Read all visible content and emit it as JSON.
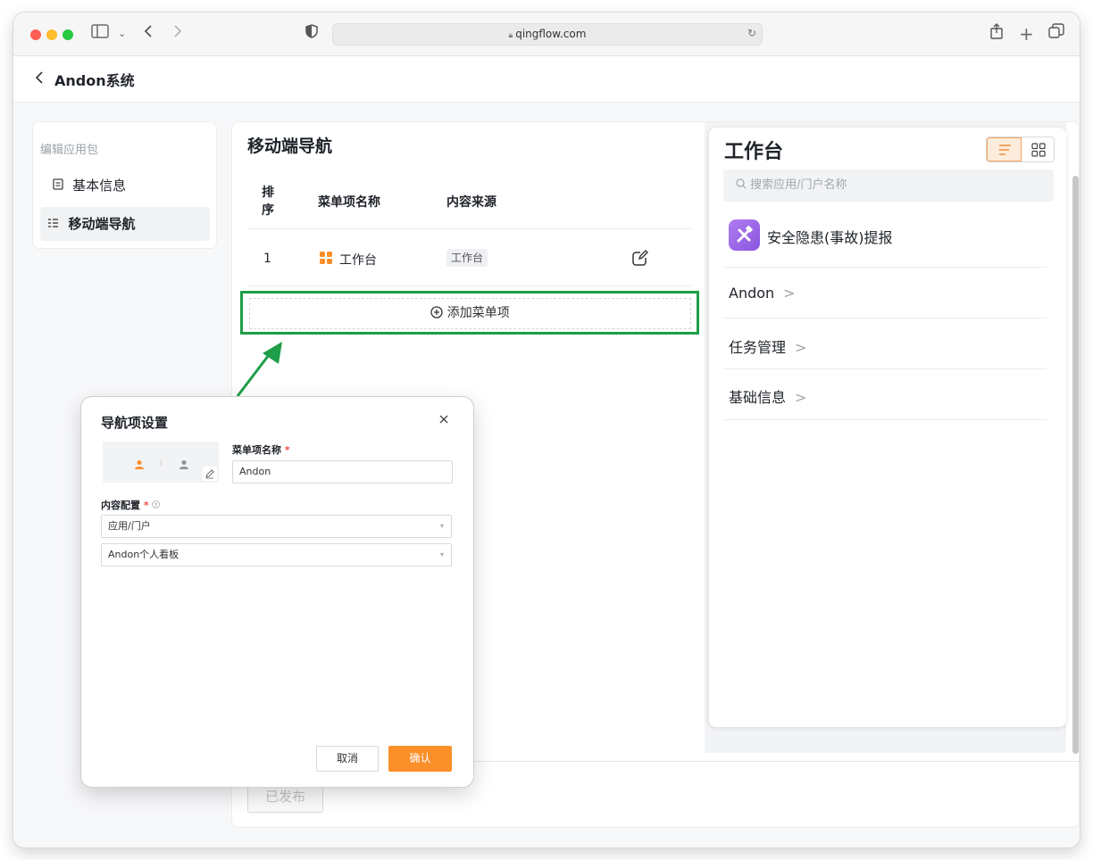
{
  "browser": {
    "url": "qingflow.com"
  },
  "header": {
    "back_icon": "chevron-left",
    "title": "Andon系统"
  },
  "sidebar": {
    "heading": "编辑应用包",
    "items": [
      {
        "label": "基本信息",
        "icon": "doc-icon",
        "active": false
      },
      {
        "label": "移动端导航",
        "icon": "list-icon",
        "active": true
      }
    ]
  },
  "main": {
    "title": "移动端导航",
    "columns": [
      "排序",
      "菜单项名称",
      "内容来源"
    ],
    "rows": [
      {
        "order": "1",
        "name": "工作台",
        "source": "工作台"
      }
    ],
    "add_label": "添加菜单项",
    "publish_label": "已发布"
  },
  "preview": {
    "title": "工作台",
    "search_placeholder": "搜索应用/门户名称",
    "app_item": "安全隐患(事故)提报",
    "groups": [
      "Andon",
      "任务管理",
      "基础信息"
    ]
  },
  "dialog": {
    "title": "导航项设置",
    "name_label": "菜单项名称",
    "name_value": "Andon",
    "content_label": "内容配置",
    "content_type": "应用/门户",
    "content_target": "Andon个人看板",
    "cancel_label": "取消",
    "ok_label": "确认",
    "required_mark": "*"
  },
  "colors": {
    "accent": "#fb8f2a",
    "highlight_box": "#1e9e48",
    "app_icon": "#9a66e8"
  }
}
